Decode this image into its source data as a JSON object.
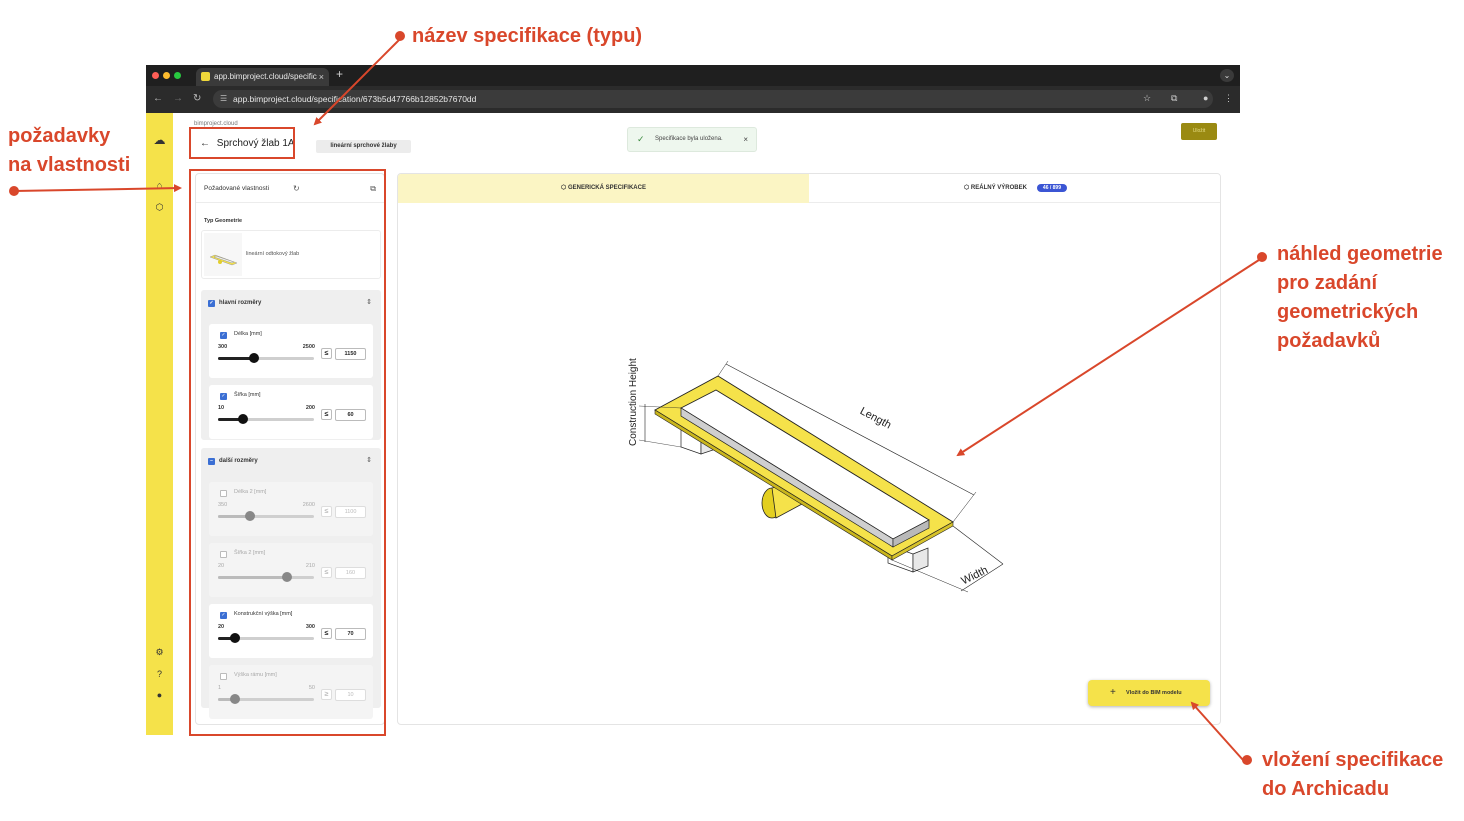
{
  "annotations": {
    "spec_name": "název specifikace (typu)",
    "properties_line1": "požadavky",
    "properties_line2": "na vlastnosti",
    "preview_line1": "náhled geometrie",
    "preview_line2": "pro zadání",
    "preview_line3": "geometrických",
    "preview_line4": "požadavků",
    "insert_line1": "vložení specifikace",
    "insert_line2": "do Archicadu",
    "color": "#d9472b"
  },
  "browser": {
    "tab_title": "app.bimproject.cloud/specific",
    "tab_close": "×",
    "new_tab": "+",
    "url": "app.bimproject.cloud/specification/673b5d47766b12852b7670dd"
  },
  "app": {
    "brand": "bimproject.cloud",
    "spec_title": "Sprchový žlab 1A",
    "category_chip": "lineární sprchové žlaby",
    "toast_text": "Specifikace byla uložena.",
    "save_label": "Uložit",
    "accent": "#f5e24a"
  },
  "panel": {
    "title": "Požadované vlastnosti",
    "geometry_label": "Typ Geometrie",
    "geometry_name": "lineární odtokový žlab",
    "groups": [
      {
        "label": "hlavní rozměry",
        "props": [
          {
            "label": "Délka [mm]",
            "min": "300",
            "max": "2500",
            "cmp": "≤",
            "value": "1150",
            "level": 0.38,
            "enabled": true
          },
          {
            "label": "Šířka [mm]",
            "min": "10",
            "max": "200",
            "cmp": "≤",
            "value": "60",
            "level": 0.26,
            "enabled": true
          }
        ]
      },
      {
        "label": "další rozměry",
        "props": [
          {
            "label": "Délka 2 [mm]",
            "min": "350",
            "max": "2600",
            "cmp": "≤",
            "value": "1100",
            "level": 0.33,
            "enabled": false
          },
          {
            "label": "Šířka 2 [mm]",
            "min": "20",
            "max": "210",
            "cmp": "≤",
            "value": "160",
            "level": 0.72,
            "enabled": false
          },
          {
            "label": "Konstrukční výška [mm]",
            "min": "20",
            "max": "300",
            "cmp": "≤",
            "value": "70",
            "level": 0.18,
            "enabled": true
          },
          {
            "label": "Výška rámu [mm]",
            "min": "1",
            "max": "50",
            "cmp": "≥",
            "value": "10",
            "level": 0.18,
            "enabled": false
          }
        ]
      }
    ]
  },
  "preview": {
    "tab_generic": "GENERICKÁ SPECIFIKACE",
    "tab_real": "REÁLNÝ VÝROBEK",
    "real_badge": "46 / 899",
    "dim_length": "Length",
    "dim_width": "Width",
    "dim_height": "Construction Height",
    "insert_button": "Vložit do BIM modelu"
  }
}
